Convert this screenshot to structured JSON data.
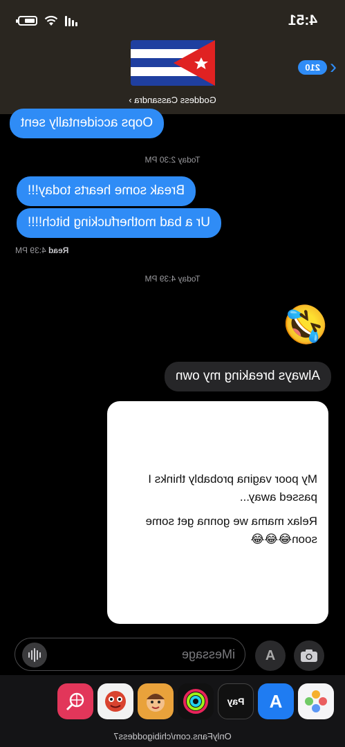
{
  "status_bar": {
    "time": "4:51"
  },
  "header": {
    "back_badge": "210",
    "contact_name": "Goddess Cassandra ›"
  },
  "messages": {
    "out_1": "Oops accidentally sent",
    "timestamp_1": "Today 2:30 PM",
    "out_2": "Break some hearts today!!!",
    "out_3": "Ur a bad motherfucking bitch!!!!",
    "read_label": "Read",
    "read_time": "4:39 PM",
    "timestamp_2": "Today 4:39 PM",
    "emoji": "🤣",
    "in_1": "Always breaking my own",
    "card_line_1": "My poor vagina probably thinks I passed away...",
    "card_line_2": "Relax mama we gonna get some soon😂😂😂"
  },
  "input": {
    "placeholder": "iMessage"
  },
  "app_tray": {
    "items": [
      "photos-app",
      "app-store",
      "apple-pay",
      "activity",
      "memoji",
      "animoji",
      "search-web"
    ],
    "pay_label": "Pay"
  },
  "footer": {
    "watermark": "OnlyFans.com/chibigoddess7"
  },
  "colors": {
    "blue_bubble": "#2f8cf6",
    "gray_bubble": "#262628",
    "header": "#2a2620"
  }
}
